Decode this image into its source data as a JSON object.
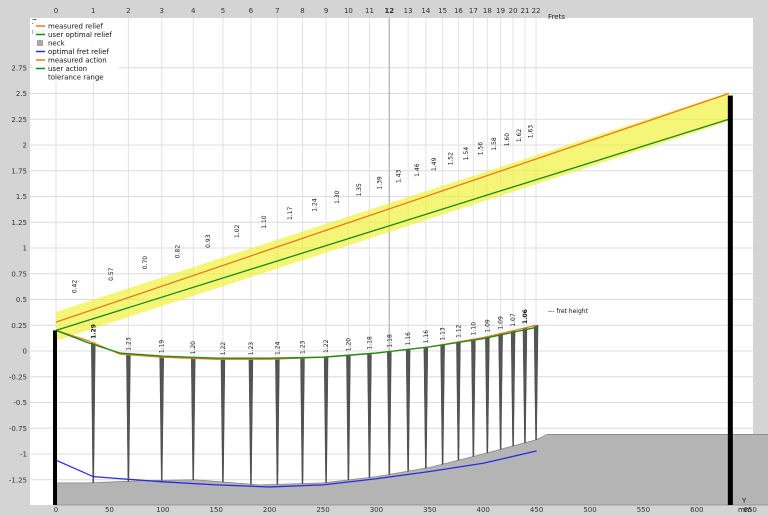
{
  "chart_data": {
    "type": "line",
    "x_axis": {
      "label": "Y",
      "unit": "mm",
      "ticks": [
        0,
        50,
        100,
        150,
        200,
        250,
        300,
        350,
        400,
        450,
        500,
        550,
        600,
        650,
        700
      ],
      "range": [
        -5,
        690
      ]
    },
    "y_axis": {
      "label": "Z",
      "unit": "mm",
      "ticks": [
        -1.25,
        -1,
        -0.75,
        -0.5,
        -0.25,
        0,
        0.25,
        0.5,
        0.75,
        1,
        1.25,
        1.5,
        1.75,
        2,
        2.25,
        2.5,
        2.75
      ],
      "tick_labels": [
        "-1.25",
        "-1",
        "-0.75",
        "-0.5",
        "-0.25",
        "0",
        "0.25",
        "0.5",
        "0.75",
        "1",
        "1.25",
        "1.5",
        "1.75",
        "2",
        "2.25",
        "2.5",
        "2.75"
      ],
      "range": [
        -1.45,
        3.2
      ]
    },
    "top_axis": {
      "label": "Frets",
      "frets": [
        0,
        1,
        2,
        3,
        4,
        5,
        6,
        7,
        8,
        9,
        10,
        11,
        12,
        13,
        14,
        15,
        16,
        17,
        18,
        19,
        20,
        21,
        22
      ],
      "highlighted": 12
    },
    "fret_x_mm": [
      0,
      34.9,
      67.8,
      99.0,
      128.5,
      156.3,
      182.5,
      207.3,
      230.8,
      252.9,
      273.8,
      293.5,
      312.1,
      329.7,
      346.3,
      362.0,
      376.8,
      390.8,
      403.9,
      416.3,
      428.0,
      439.1,
      449.5
    ],
    "frets_heights": [
      "1.29",
      "1.23",
      "1.19",
      "1.20",
      "1.22",
      "1.23",
      "1.24",
      "1.23",
      "1.22",
      "1.20",
      "1.18",
      "1.18",
      "1.16",
      "1.16",
      "1.13",
      "1.12",
      "1.10",
      "1.09",
      "1.09",
      "1.07",
      "1.06"
    ],
    "string_height_labels": [
      "0.42",
      "0.57",
      "0.70",
      "0.82",
      "0.93",
      "1.02",
      "1.10",
      "1.17",
      "1.24",
      "1.30",
      "1.35",
      "1.39",
      "1.43",
      "1.46",
      "1.49",
      "1.52",
      "1.54",
      "1.56",
      "1.58",
      "1.60",
      "1.62",
      "1.63"
    ],
    "fret_height_note": "--- fret height",
    "nut": {
      "x": 0,
      "top": 0.2
    },
    "saddle": {
      "x": 630,
      "top": 2.48
    },
    "series": [
      {
        "name": "measured relief",
        "color": "#e87a1a",
        "points": [
          [
            0,
            0.2
          ],
          [
            30,
            0.1
          ],
          [
            60,
            -0.03
          ],
          [
            100,
            -0.06
          ],
          [
            150,
            -0.08
          ],
          [
            200,
            -0.08
          ],
          [
            250,
            -0.06
          ],
          [
            300,
            -0.02
          ],
          [
            350,
            0.04
          ],
          [
            400,
            0.13
          ],
          [
            450,
            0.25
          ]
        ]
      },
      {
        "name": "user optimal relief",
        "color": "#1a8a1a",
        "points": [
          [
            0,
            0.2
          ],
          [
            30,
            0.08
          ],
          [
            60,
            -0.02
          ],
          [
            100,
            -0.05
          ],
          [
            150,
            -0.07
          ],
          [
            200,
            -0.07
          ],
          [
            250,
            -0.06
          ],
          [
            300,
            -0.02
          ],
          [
            350,
            0.04
          ],
          [
            400,
            0.12
          ],
          [
            450,
            0.23
          ]
        ]
      },
      {
        "name": "optimal fret relief",
        "color": "#2a2ae0",
        "points": [
          [
            0,
            -1.06
          ],
          [
            35,
            -1.22
          ],
          [
            100,
            -1.27
          ],
          [
            150,
            -1.3
          ],
          [
            200,
            -1.32
          ],
          [
            250,
            -1.3
          ],
          [
            300,
            -1.24
          ],
          [
            350,
            -1.17
          ],
          [
            400,
            -1.09
          ],
          [
            450,
            -0.97
          ]
        ]
      },
      {
        "name": "measured action",
        "color": "#e87a1a",
        "points": [
          [
            0,
            0.28
          ],
          [
            630,
            2.5
          ]
        ]
      },
      {
        "name": "user action",
        "color": "#1a8a1a",
        "points": [
          [
            0,
            0.2
          ],
          [
            630,
            2.25
          ]
        ]
      }
    ],
    "tolerance_range": {
      "name": "tolerance range",
      "color": "#f0f030",
      "center": [
        [
          0,
          0.24
        ],
        [
          630,
          2.37
        ]
      ],
      "half_width": 0.14
    },
    "neck": {
      "name": "neck",
      "color": "#b4b4b4",
      "outline": [
        [
          0,
          -1.28
        ],
        [
          30,
          -1.28
        ],
        [
          80,
          -1.26
        ],
        [
          130,
          -1.25
        ],
        [
          190,
          -1.3
        ],
        [
          250,
          -1.28
        ],
        [
          300,
          -1.22
        ],
        [
          350,
          -1.13
        ],
        [
          400,
          -1.0
        ],
        [
          450,
          -0.86
        ],
        [
          460,
          -0.81
        ],
        [
          690,
          -0.81
        ]
      ]
    },
    "legend": {
      "position": "top-left",
      "entries": [
        {
          "label": "measured relief",
          "color": "#e87a1a",
          "kind": "line"
        },
        {
          "label": "user optimal relief",
          "color": "#1a8a1a",
          "kind": "line"
        },
        {
          "label": "neck",
          "color": "#a8a8a8",
          "kind": "box"
        },
        {
          "label": "optimal fret relief",
          "color": "#2a2ae0",
          "kind": "line"
        },
        {
          "label": "measured action",
          "color": "#e87a1a",
          "kind": "line"
        },
        {
          "label": "user action",
          "color": "#1a8a1a",
          "kind": "line"
        },
        {
          "label": "tolerance range",
          "color": "#f0f030",
          "kind": "none"
        }
      ]
    }
  }
}
